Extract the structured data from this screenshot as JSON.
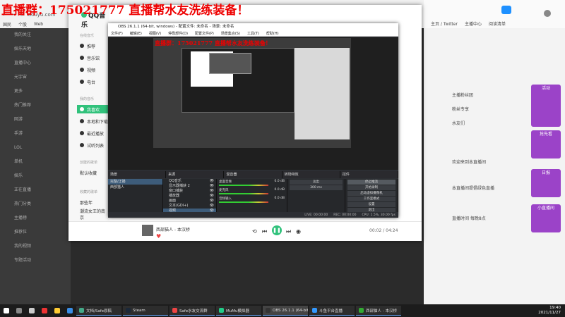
{
  "overlay": {
    "title": "直播群：175021777 直播帮水友洗练装备！"
  },
  "browser": {
    "url": "douyu.com",
    "bookmarks": [
      "国民",
      "个股",
      "Web"
    ],
    "right_bookmarks": [
      "主页 / Twitter",
      "主播中心",
      "阅读清单"
    ]
  },
  "left_sidebar": {
    "items": [
      "我的关注",
      "娱乐天地",
      "直播中心",
      "元宇宙",
      "更多",
      "热门推荐",
      "网游",
      "手游",
      "LOL",
      "单机",
      "娱乐",
      "正在直播",
      "热门分类",
      "主播榜",
      "推荐位",
      "我的视频",
      "专题活动"
    ]
  },
  "qq": {
    "logo": "QQ音乐",
    "section_online": "在线音乐",
    "nav": [
      "推荐",
      "音乐馆",
      "视频",
      "电台"
    ],
    "section_mine": "我的音乐",
    "mine": [
      "我喜欢",
      "本地和下载",
      "最近播放",
      "试听列表"
    ],
    "section_created": "创建的歌单",
    "created": [
      "默认收藏"
    ],
    "section_fav": "收藏的歌单",
    "fav": [
      "那些年",
      "潮流女王的南京"
    ],
    "player": {
      "song": "西部猫人 - 本汉桥",
      "time": "00:02 / 04:24"
    }
  },
  "obs": {
    "title": "OBS 26.1.1 (64-bit, windows) - 配置文件: 未命名 - 场景: 未命名",
    "menu": [
      "文件(F)",
      "编辑(E)",
      "视图(V)",
      "停靠部件(D)",
      "配置文件(P)",
      "场景集合(S)",
      "工具(T)",
      "帮助(H)"
    ],
    "preview_title": "直播群：175021777 直播帮水友洗练装备！",
    "docks": [
      "场景",
      "来源",
      "混音器",
      "转场特效",
      "控件"
    ],
    "scenes": [
      "完整/正播",
      "西部猫人"
    ],
    "sources": [
      "QQ音乐",
      "显示器捕获 2",
      "窗口捕获",
      "播放器",
      "画面",
      "文本(GDI+)",
      "视频"
    ],
    "mixer": [
      {
        "name": "桌面音频",
        "db": "0.0 dB"
      },
      {
        "name": "麦克风",
        "db": "0.0 dB"
      },
      {
        "name": "音频输入",
        "db": "0.0 dB"
      }
    ],
    "transition": {
      "type": "淡出",
      "duration": "300 ms"
    },
    "controls": [
      "停止推流",
      "开始录制",
      "启动虚拟摄像机",
      "工作室模式",
      "设置",
      "退出"
    ],
    "status": [
      "LIVE: 00:00:00",
      "REC: 00:00:00",
      "CPU: 1.5%, 30.00 fps"
    ]
  },
  "right_panel": {
    "items": [
      "主播粉丝团",
      "粉丝专享",
      "水友们",
      "欢迎来到本直播间",
      "本直播间提倡绿色直播",
      "直播时间 每晚8点"
    ],
    "promo": [
      "活动",
      "抢先看",
      "日报",
      "小直播间"
    ]
  },
  "taskbar": {
    "apps": [
      "文档/Safe原稿",
      "Steam",
      "Safe水友交流群",
      "MuMu模拟器",
      "OBS 26.1.1 (64-bit)",
      "斗鱼平台直播",
      "西部猫人 - 本汉桥"
    ],
    "time": "19:40",
    "date": "2021/11/27"
  },
  "colors": {
    "accent": "#31c27c",
    "obs_bg": "#2c2e33",
    "overlay_red": "#ee0000"
  }
}
